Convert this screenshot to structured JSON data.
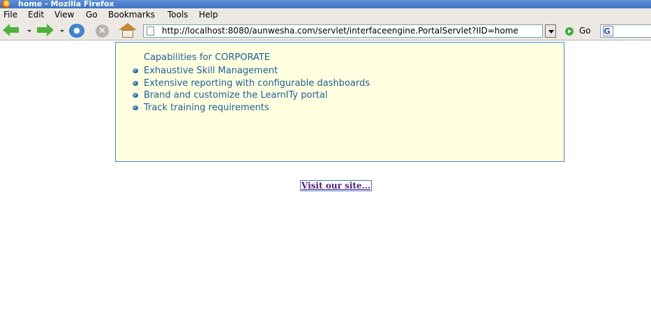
{
  "window": {
    "title": "home - Mozilla Firefox"
  },
  "menubar": {
    "items": [
      {
        "label": "File"
      },
      {
        "label": "Edit"
      },
      {
        "label": "View"
      },
      {
        "label": "Go"
      },
      {
        "label": "Bookmarks"
      },
      {
        "label": "Tools"
      },
      {
        "label": "Help"
      }
    ]
  },
  "toolbar": {
    "url": "http://localhost:8080/aunwesha.com/servlet/interfaceengine.PortalServlet?IID=home",
    "go_label": "Go",
    "search_engine_glyph": "G"
  },
  "content": {
    "heading": "Capabilities for CORPORATE",
    "features": [
      "Exhaustive Skill Management",
      "Extensive reporting with configurable dashboards",
      "Brand and customize the LearnITy portal",
      "Track training requirements"
    ],
    "visit_link": "Visit our site..."
  },
  "colors": {
    "content_background": "#ffffe0",
    "content_border": "#3d8bd0",
    "content_text": "#1f5e97",
    "link_text": "#4b1d7a"
  }
}
